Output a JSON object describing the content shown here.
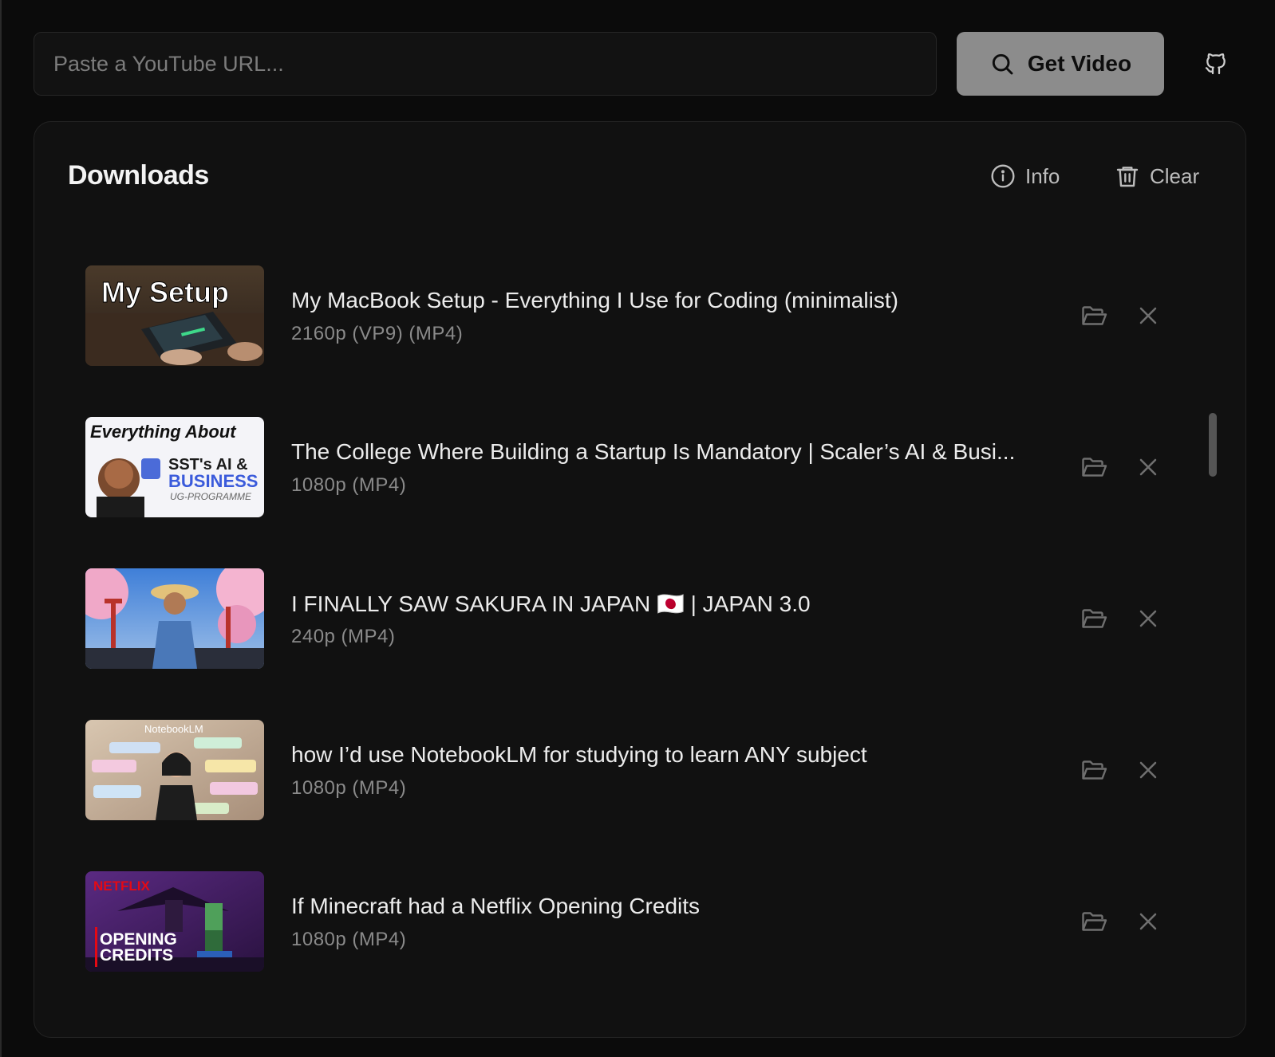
{
  "search": {
    "placeholder": "Paste a YouTube URL...",
    "value": ""
  },
  "get_button": {
    "label": "Get Video",
    "icon": "search-icon"
  },
  "github": {
    "icon": "github-icon"
  },
  "downloads": {
    "title": "Downloads",
    "info_label": "Info",
    "clear_label": "Clear",
    "items": [
      {
        "title": "My MacBook Setup - Everything I Use for Coding (minimalist)",
        "meta": "2160p (VP9) (MP4)",
        "thumb_text": "My Setup"
      },
      {
        "title": "The College Where Building a Startup Is Mandatory | Scaler’s AI & Busi...",
        "meta": "1080p (MP4)",
        "thumb_text_1": "Everything About",
        "thumb_text_2": "SST's AI &",
        "thumb_text_3": "BUSINESS",
        "thumb_text_4": "UG-PROGRAMME"
      },
      {
        "title": "I FINALLY SAW SAKURA IN JAPAN 🇯🇵 | JAPAN 3.0",
        "meta": "240p (MP4)"
      },
      {
        "title": "how I’d use NotebookLM for studying to learn ANY subject",
        "meta": "1080p (MP4)",
        "thumb_text": "NotebookLM"
      },
      {
        "title": "If Minecraft had a Netflix Opening Credits",
        "meta": "1080p (MP4)",
        "thumb_text_1": "NETFLIX",
        "thumb_text_2": "OPENING",
        "thumb_text_3": "CREDITS"
      }
    ]
  },
  "colors": {
    "background": "#0b0b0b",
    "panel": "#111111",
    "button": "#8c8c8c",
    "muted_text": "#8a8a8a"
  }
}
